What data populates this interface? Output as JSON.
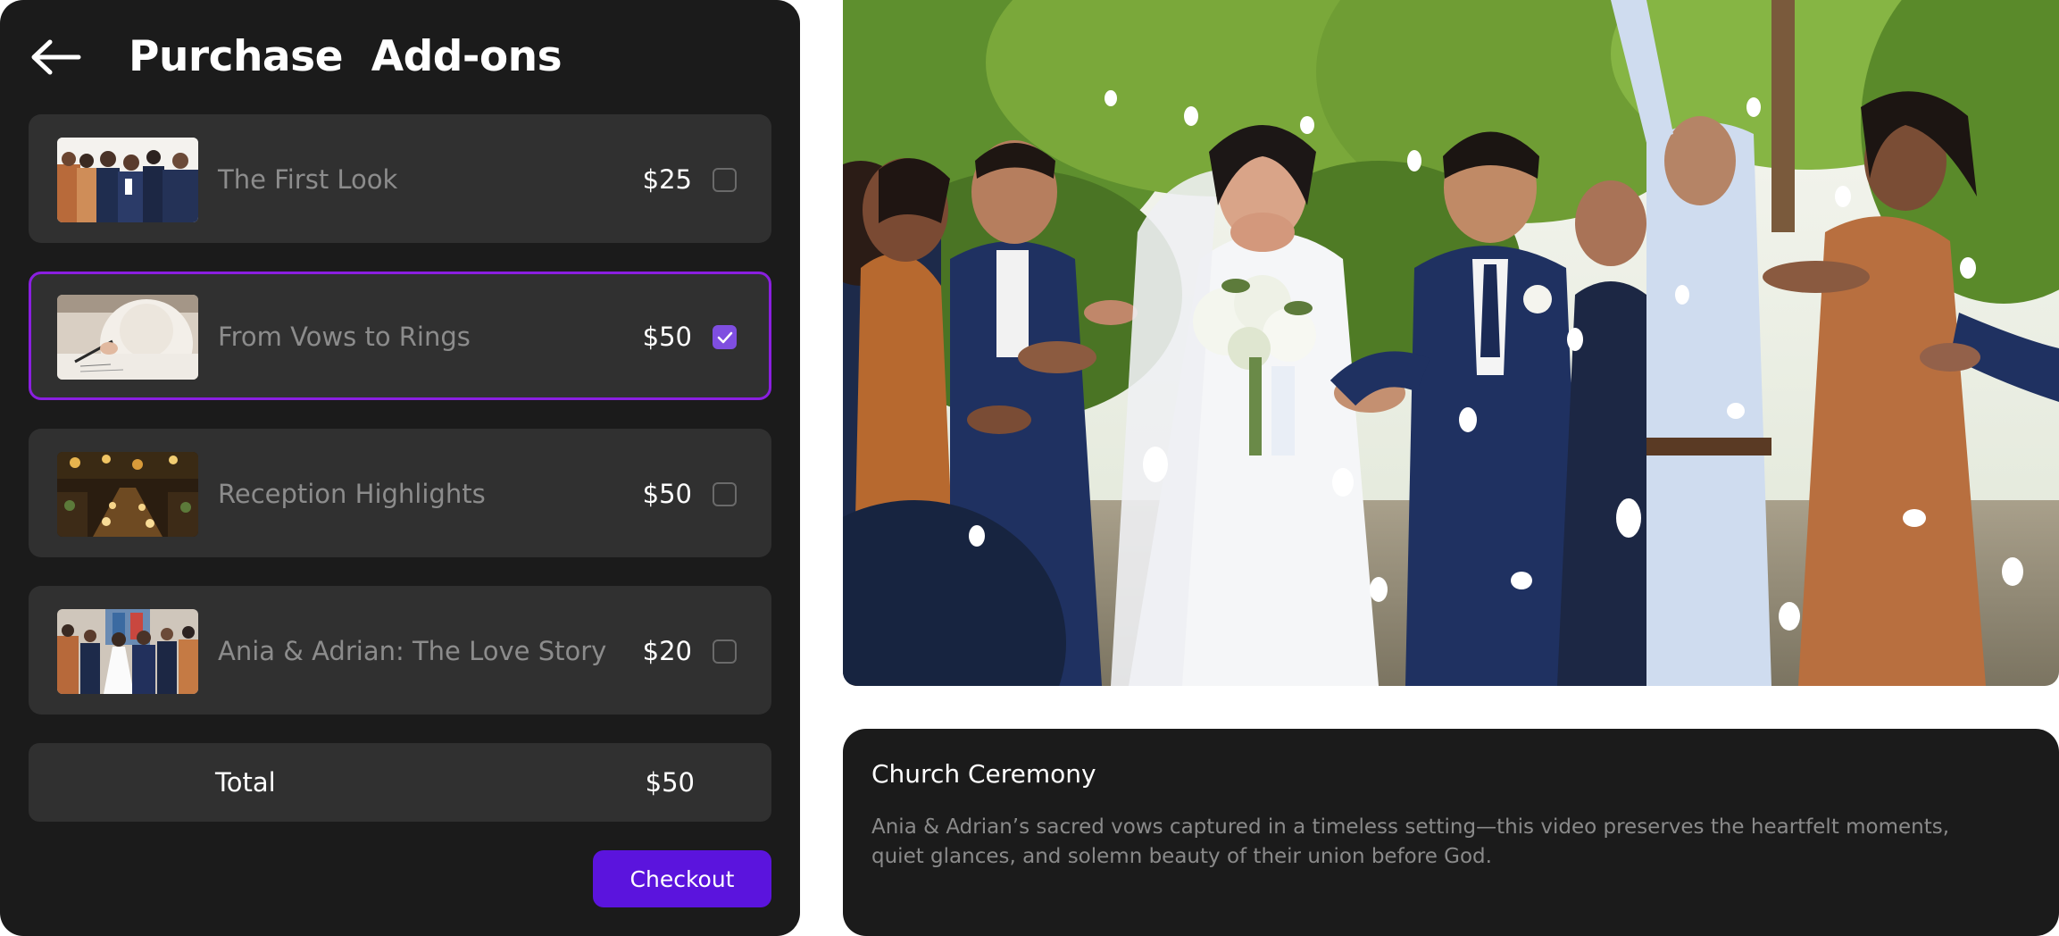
{
  "header": {
    "title": "Purchase  Add-ons",
    "back_icon": "arrow-left-icon"
  },
  "addons": [
    {
      "name": "The First Look",
      "price": "$25",
      "checked": false,
      "thumbnail": "groom-with-groomsmen"
    },
    {
      "name": "From Vows to Rings",
      "price": "$50",
      "checked": true,
      "thumbnail": "signing-document"
    },
    {
      "name": "Reception Highlights",
      "price": "$50",
      "checked": false,
      "thumbnail": "reception-hall"
    },
    {
      "name": "Ania & Adrian: The Love Story",
      "price": "$20",
      "checked": false,
      "thumbnail": "church-aisle"
    }
  ],
  "total": {
    "label": "Total",
    "value": "$50"
  },
  "checkout": {
    "label": "Checkout"
  },
  "video": {
    "title": "Church Ceremony",
    "description": "Ania & Adrian’s sacred vows captured in a timeless setting—this video preserves the heartfelt moments, quiet glances, and solemn beauty of their union before God."
  },
  "colors": {
    "panel_bg": "#1b1b1b",
    "row_bg": "#303030",
    "selected_border": "#8a1fe0",
    "checkbox_checked": "#7f4ee0",
    "checkout_bg": "#5b14dd"
  }
}
